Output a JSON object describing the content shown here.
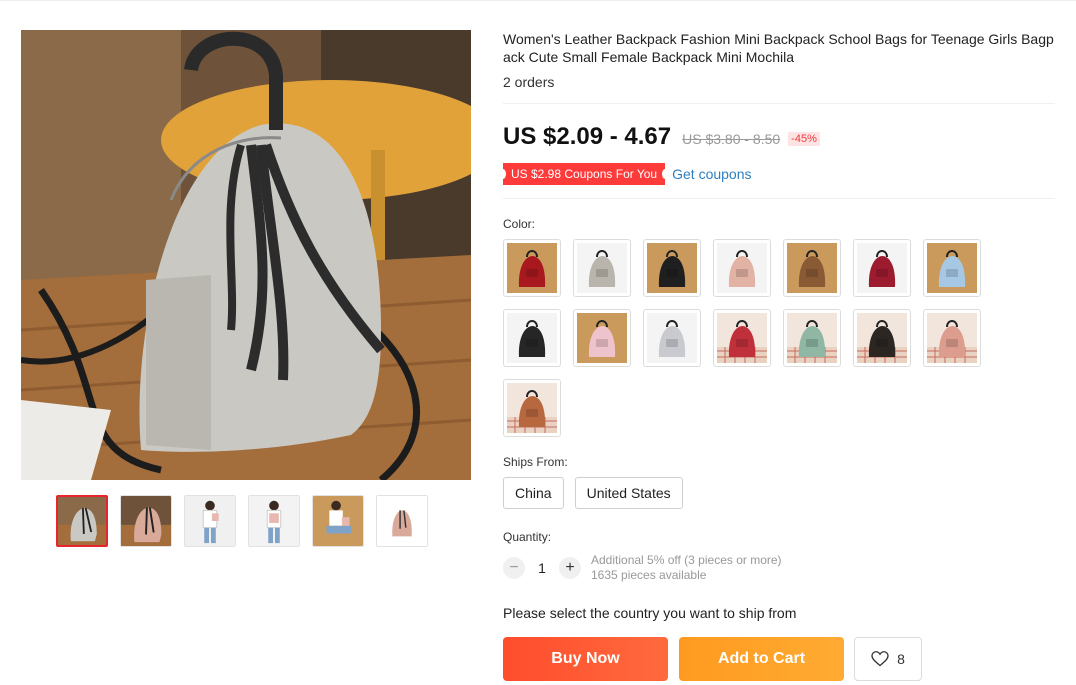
{
  "product": {
    "title": "Women's Leather Backpack Fashion Mini Backpack School Bags for Teenage Girls Bagpack Cute Small Female Backpack Mini Mochila",
    "orders": "2 orders",
    "price": "US $2.09 - 4.67",
    "original_price": "US $3.80 - 8.50",
    "discount": "-45%",
    "coupon_label": "US $2.98 Coupons For You",
    "get_coupons": "Get coupons",
    "color_label": "Color:",
    "colors": [
      {
        "name": "red",
        "color": "#a8191f"
      },
      {
        "name": "gray",
        "color": "#b9b5ad"
      },
      {
        "name": "black",
        "color": "#1f1f1f"
      },
      {
        "name": "pink",
        "color": "#e2b2a4"
      },
      {
        "name": "brown",
        "color": "#8a5a34"
      },
      {
        "name": "wine",
        "color": "#9c1b2e"
      },
      {
        "name": "light-blue",
        "color": "#a7c8e4"
      },
      {
        "name": "black-2",
        "color": "#262626"
      },
      {
        "name": "light-pink",
        "color": "#efc3cb"
      },
      {
        "name": "silver",
        "color": "#c9cad0"
      },
      {
        "name": "plaid-red",
        "color": "#c0303a"
      },
      {
        "name": "plaid-green",
        "color": "#8fb7a4"
      },
      {
        "name": "plaid-black",
        "color": "#2b2622"
      },
      {
        "name": "plaid-pink",
        "color": "#dc9d8e"
      },
      {
        "name": "plaid-brown",
        "color": "#b8683f"
      }
    ],
    "ships_from_label": "Ships From:",
    "ships_from": [
      "China",
      "United States"
    ],
    "quantity_label": "Quantity:",
    "quantity": "1",
    "qty_minus": "−",
    "qty_plus": "+",
    "qty_note_1": "Additional 5% off (3 pieces or more)",
    "qty_note_2": "1635 pieces available",
    "ship_prompt": "Please select the country you want to ship from",
    "buy_now": "Buy Now",
    "add_to_cart": "Add to Cart",
    "wishlist_count": "8"
  },
  "colors": {
    "price": "#111111",
    "discount": "#f03c3c",
    "coupon_bg": "#fe3b3b",
    "link": "#2f7fbf",
    "buy_now": "#ff4d2d",
    "add_to_cart": "#ff9a1f",
    "thumb_active": "#e6262c"
  },
  "gallery": {
    "thumbnails": [
      "backpack-gray",
      "backpack-pink",
      "model-front",
      "model-back",
      "model-sitting",
      "backpack-pink-flat"
    ]
  }
}
